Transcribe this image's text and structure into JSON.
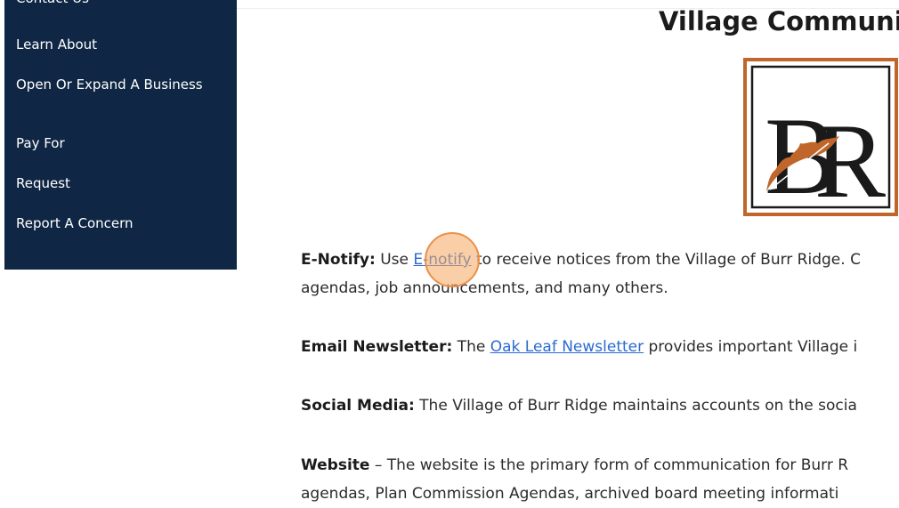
{
  "sidebar": {
    "items": [
      {
        "label": "Contact Us"
      },
      {
        "label": "Learn About"
      },
      {
        "label": "Open Or Expand A Business"
      },
      {
        "label": "Pay For"
      },
      {
        "label": "Request"
      },
      {
        "label": "Report A Concern"
      }
    ]
  },
  "main": {
    "title": "Village Communic",
    "logo": {
      "letters": "BR"
    },
    "paragraphs": {
      "enotify": {
        "label": "E-Notify:",
        "before": " Use ",
        "link": "E-notify",
        "after": " to receive notices from the Village of Burr Ridge. C",
        "line2": "agendas, job announcements, and many others."
      },
      "newsletter": {
        "label": "Email Newsletter:",
        "before": " The ",
        "link": "Oak Leaf Newsletter",
        "after": " provides important Village i"
      },
      "social": {
        "label": "Social Media:",
        "text": " The Village of Burr Ridge maintains accounts on the socia"
      },
      "website": {
        "label": "Website",
        "text": " – The website is the primary form of communication for Burr R",
        "line2": "agendas, Plan Commission Agendas, archived board meeting informati"
      }
    }
  },
  "colors": {
    "sidebar_bg": "#0f2744",
    "link": "#2a6bd1",
    "logo_border": "#c0662a",
    "cursor_highlight": "#f6a860"
  }
}
